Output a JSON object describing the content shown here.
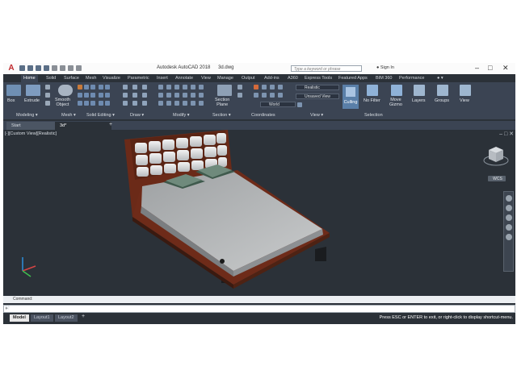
{
  "app": {
    "title": "Autodesk AutoCAD 2018",
    "filename": "3d.dwg",
    "search_placeholder": "Type a keyword or phrase",
    "signin": "Sign In"
  },
  "ribbon_tabs": [
    "Home",
    "Solid",
    "Surface",
    "Mesh",
    "Visualize",
    "Parametric",
    "Insert",
    "Annotate",
    "View",
    "Manage",
    "Output",
    "Add-ins",
    "A360",
    "Express Tools",
    "Featured Apps",
    "BIM 360",
    "Performance"
  ],
  "ribbon": {
    "box": "Box",
    "extrude": "Extrude",
    "smooth_object_1": "Smooth",
    "smooth_object_2": "Object",
    "section_plane_1": "Section",
    "section_plane_2": "Plane",
    "visual_style": "Realistic",
    "named_view": "Unsaved View",
    "ucs_world": "World",
    "culling": "Culling",
    "no_filter": "No Filter",
    "move_gizmo_1": "Move",
    "move_gizmo_2": "Gizmo",
    "layers": "Layers",
    "groups": "Groups",
    "view": "View"
  },
  "panels": [
    "Modeling",
    "Mesh",
    "Solid Editing",
    "Draw",
    "Modify",
    "Section",
    "Coordinates",
    "View",
    "Selection"
  ],
  "doc_tabs": [
    "Start",
    "3d*"
  ],
  "viewport_label": "[-][Custom View][Realistic]",
  "viewcube": {
    "wcs": "WCS"
  },
  "command": {
    "history": "Command:"
  },
  "layout_tabs": [
    "Model",
    "Layout1",
    "Layout2"
  ],
  "status_message": "Press ESC or ENTER to exit, or right-click to display shortcut-menu.",
  "colors": {
    "chrome": "#3b4453",
    "canvas": "#2b3138",
    "accent": "#5a7fa8",
    "logo": "#c0282d"
  }
}
